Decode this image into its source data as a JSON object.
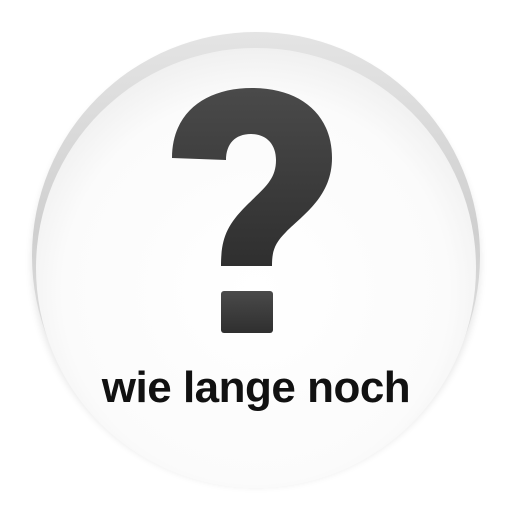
{
  "app": {
    "title": "wie lange noch",
    "icon": "question-mark-icon",
    "colors": {
      "badge_face": "#ffffff",
      "badge_rim": "#d6d6d6",
      "glyph": "#3a3a3a",
      "title_text": "#111111"
    }
  }
}
